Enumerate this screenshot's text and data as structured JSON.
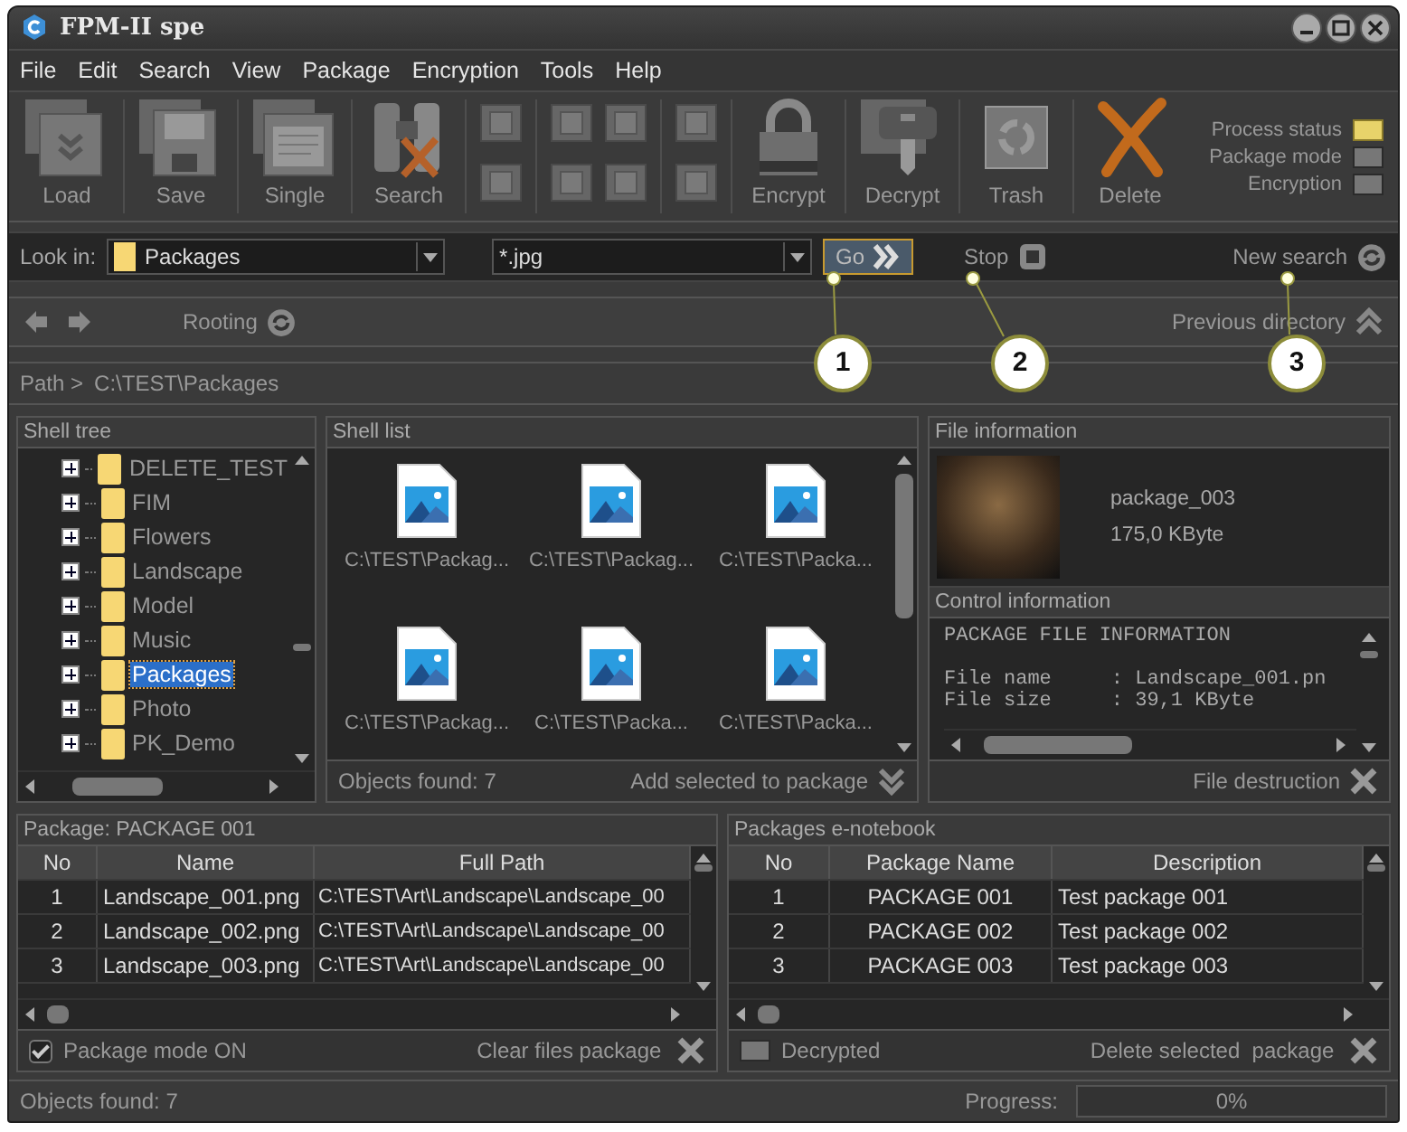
{
  "window": {
    "title": "FPM-II spe"
  },
  "menu": [
    "File",
    "Edit",
    "Search",
    "View",
    "Package",
    "Encryption",
    "Tools",
    "Help"
  ],
  "tools_left": [
    {
      "label": "Load"
    },
    {
      "label": "Save"
    },
    {
      "label": "Single"
    },
    {
      "label": "Search"
    }
  ],
  "tools_right": [
    {
      "label": "Encrypt"
    },
    {
      "label": "Decrypt"
    },
    {
      "label": "Trash"
    },
    {
      "label": "Delete"
    }
  ],
  "indicators": [
    {
      "label": "Process status",
      "on": true
    },
    {
      "label": "Package mode",
      "on": false
    },
    {
      "label": "Encryption",
      "on": false
    }
  ],
  "search_bar": {
    "look_in_label": "Look in:",
    "folder": "Packages",
    "mask": "*.jpg",
    "go": "Go",
    "stop": "Stop",
    "new_search": "New search"
  },
  "nav": {
    "rooting": "Rooting",
    "previous_directory": "Previous directory"
  },
  "path": {
    "label": "Path >",
    "value": "C:\\TEST\\Packages"
  },
  "callouts": [
    "1",
    "2",
    "3"
  ],
  "shell_tree": {
    "title": "Shell tree",
    "items": [
      {
        "label": "DELETE_TEST",
        "selected": false
      },
      {
        "label": "FIM",
        "selected": false
      },
      {
        "label": "Flowers",
        "selected": false
      },
      {
        "label": "Landscape",
        "selected": false
      },
      {
        "label": "Model",
        "selected": false
      },
      {
        "label": "Music",
        "selected": false
      },
      {
        "label": "Packages",
        "selected": true
      },
      {
        "label": "Photo",
        "selected": false
      },
      {
        "label": "PK_Demo",
        "selected": false
      }
    ]
  },
  "shell_list": {
    "title": "Shell list",
    "items": [
      "C:\\TEST\\Packag...",
      "C:\\TEST\\Packag...",
      "C:\\TEST\\Packa...",
      "C:\\TEST\\Packag...",
      "C:\\TEST\\Packa...",
      "C:\\TEST\\Packa..."
    ],
    "status": "Objects found: 7",
    "action": "Add selected to package"
  },
  "file_info": {
    "title": "File information",
    "name": "package_003",
    "size": "175,0 KByte"
  },
  "control_info": {
    "title": "Control information",
    "heading": "PACKAGE FILE INFORMATION",
    "lines": [
      "File name     : Landscape_001.pn",
      "File size     : 39,1 KByte"
    ],
    "action": "File destruction"
  },
  "package_table": {
    "title": "Package: PACKAGE 001",
    "columns": [
      "No",
      "Name",
      "Full Path"
    ],
    "rows": [
      [
        "1",
        "Landscape_001.png",
        "C:\\TEST\\Art\\Landscape\\Landscape_00"
      ],
      [
        "2",
        "Landscape_002.png",
        "C:\\TEST\\Art\\Landscape\\Landscape_00"
      ],
      [
        "3",
        "Landscape_003.png",
        "C:\\TEST\\Art\\Landscape\\Landscape_00"
      ]
    ],
    "checkbox": {
      "label": "Package mode ON",
      "checked": true
    },
    "action": "Clear files package"
  },
  "notebook": {
    "title": "Packages e-notebook",
    "columns": [
      "No",
      "Package Name",
      "Description"
    ],
    "rows": [
      [
        "1",
        "PACKAGE 001",
        "Test package 001"
      ],
      [
        "2",
        "PACKAGE 002",
        "Test package 002"
      ],
      [
        "3",
        "PACKAGE 003",
        "Test package 003"
      ]
    ],
    "toggle": {
      "label": "Decrypted",
      "on": false
    },
    "action": "Delete selected  package"
  },
  "status_bar": {
    "text": "Objects found: 7",
    "progress_label": "Progress:",
    "level": 0,
    "reading": "0%"
  }
}
